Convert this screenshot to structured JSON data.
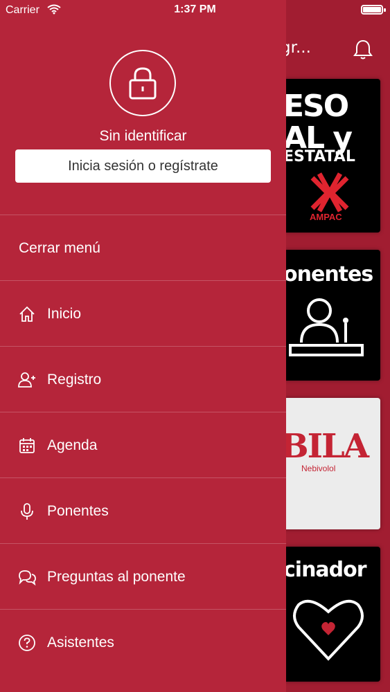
{
  "status_bar": {
    "carrier": "Carrier",
    "time": "1:37 PM"
  },
  "background": {
    "header_title_partial": "gr...",
    "tiles": [
      {
        "line1": "ESO",
        "line2": "AL y",
        "line3": "ESTATAL",
        "logo_text": "AMPAC"
      },
      {
        "line1": "onentes"
      },
      {
        "brand": "BILA",
        "brand_sub": "Nebivolol"
      },
      {
        "line1": "cinador"
      }
    ]
  },
  "drawer": {
    "user_status": "Sin identificar",
    "login_button": "Inicia sesión o regístrate",
    "menu": [
      {
        "label": "Cerrar menú",
        "icon": ""
      },
      {
        "label": "Inicio",
        "icon": "home-icon"
      },
      {
        "label": "Registro",
        "icon": "add-user-icon"
      },
      {
        "label": "Agenda",
        "icon": "calendar-icon"
      },
      {
        "label": "Ponentes",
        "icon": "microphone-icon"
      },
      {
        "label": "Preguntas al ponente",
        "icon": "chat-bubbles-icon"
      },
      {
        "label": "Asistentes",
        "icon": "help-circle-icon"
      }
    ]
  },
  "colors": {
    "drawer": "#b5253a",
    "background": "#a11d31",
    "accent_red": "#e0242f"
  }
}
